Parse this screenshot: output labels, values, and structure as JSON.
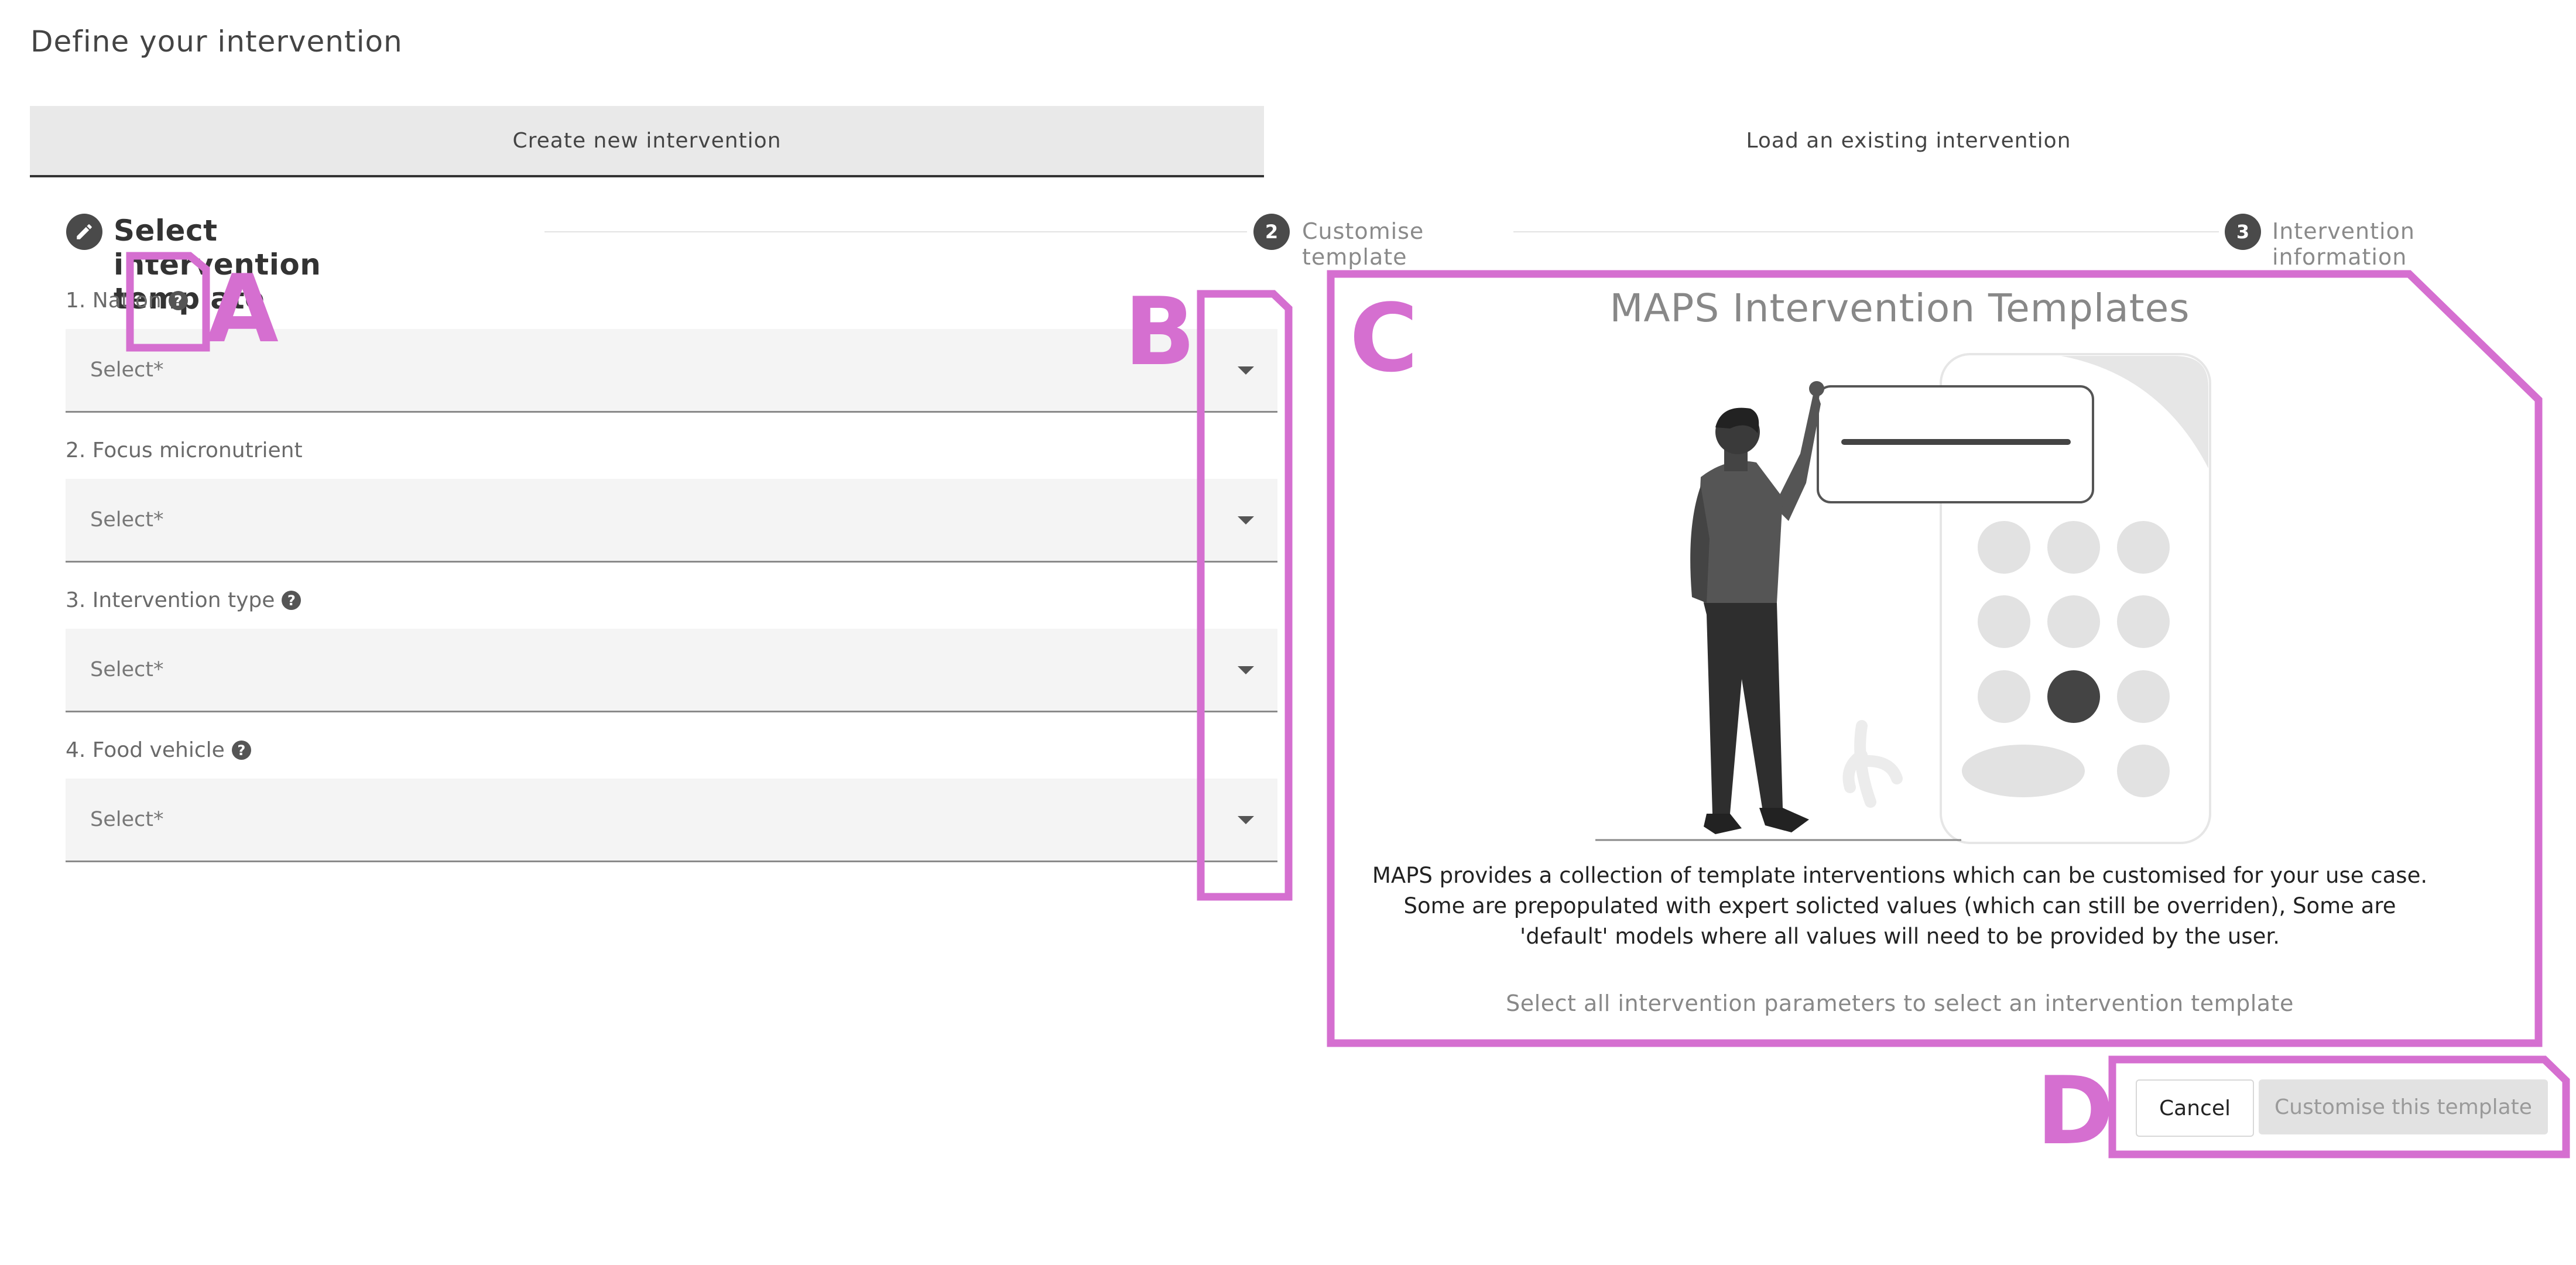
{
  "page": {
    "title": "Define your intervention"
  },
  "tabs": [
    {
      "label": "Create new intervention",
      "active": true
    },
    {
      "label": "Load an existing intervention",
      "active": false
    }
  ],
  "stepper": {
    "current_icon": "pencil-icon",
    "steps": [
      {
        "label": "Select intervention template"
      },
      {
        "number": "2",
        "label": "Customise template"
      },
      {
        "number": "3",
        "label": "Intervention information"
      }
    ]
  },
  "form": {
    "fields": [
      {
        "label": "1. Nation",
        "help_icon": true,
        "value": "Select*"
      },
      {
        "label": "2. Focus micronutrient",
        "help_icon": false,
        "value": "Select*"
      },
      {
        "label": "3. Intervention type",
        "help_icon": true,
        "value": "Select*"
      },
      {
        "label": "4. Food vehicle",
        "help_icon": true,
        "value": "Select*"
      }
    ],
    "help_glyph": "?"
  },
  "template_panel": {
    "title": "MAPS Intervention Templates",
    "description": "MAPS provides a collection of template interventions which can be customised for your use case. Some are prepopulated with expert solicted values (which can still be overriden), Some are 'default' models where all values will need to be provided by the user.",
    "hint": "Select all intervention parameters to select an intervention template"
  },
  "actions": {
    "cancel_label": "Cancel",
    "customise_label": "Customise this template",
    "customise_disabled": true
  },
  "annotations": {
    "A": "A",
    "B": "B",
    "C": "C",
    "D": "D"
  },
  "colors": {
    "annotation": "#d56fd0",
    "dark": "#4a4a4a",
    "field_bg": "#f4f4f4",
    "tab_active_bg": "#e9e9e9",
    "button_disabled_bg": "#e2e2e2"
  }
}
